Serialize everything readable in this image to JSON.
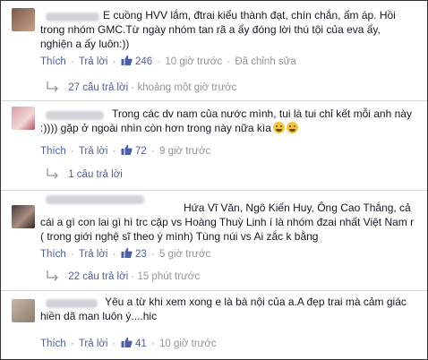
{
  "comments": [
    {
      "text_parts": [
        "E cuồng HVV lắm, đtrai kiểu thành đạt, chín chắn, ấm áp. Hồi trong nhóm GMC.Từ ngày nhóm tan rã a ấy đóng lời thú tội của eva ấy, nghiện a ấy luôn:))"
      ],
      "like_label": "Thích",
      "reply_label": "Trả lời",
      "like_count": "246",
      "time": "10 giờ trước",
      "edited": "Đã chỉnh sửa",
      "replies_text": "27 câu trả lời",
      "replies_time": "khoảng một giờ trước"
    },
    {
      "text": "Trong các dv nam của nước mình, tui là tui chỉ kết mỗi anh này :)))) gặp ở ngoài nhìn còn hơn trong này nữa kìa",
      "emojis": [
        "crying-face",
        "crying-face"
      ],
      "like_label": "Thích",
      "reply_label": "Trả lời",
      "like_count": "72",
      "time": "9 giờ trước",
      "replies_text": "1 câu trả lời"
    },
    {
      "text": "Hứa Vĩ Văn, Ngô Kiến Huy, Ông Cao Thắng, cả cái a gì con lai gì hì trc cặp vs Hoàng Thuỳ Linh í là nhóm đzai nhất Việt Nam r ( trong giới nghệ sĩ theo ý mình) Tùng núi vs Ai zắc k bằng",
      "like_label": "Thích",
      "reply_label": "Trả lời",
      "like_count": "23",
      "time": "5 giờ trước",
      "replies_text": "22 câu trả lời",
      "replies_time": "15 phút trước"
    },
    {
      "text": "Yêu a từ khi xem xong e là bà nội của a.A đẹp trai mà cảm giác hiền dã man luôn ý....hic",
      "like_label": "Thích",
      "reply_label": "Trả lời",
      "like_count": "41",
      "time": "10 giờ trước"
    }
  ],
  "colors": {
    "link": "#4b5ea8",
    "meta": "#90949c",
    "text": "#141823"
  }
}
